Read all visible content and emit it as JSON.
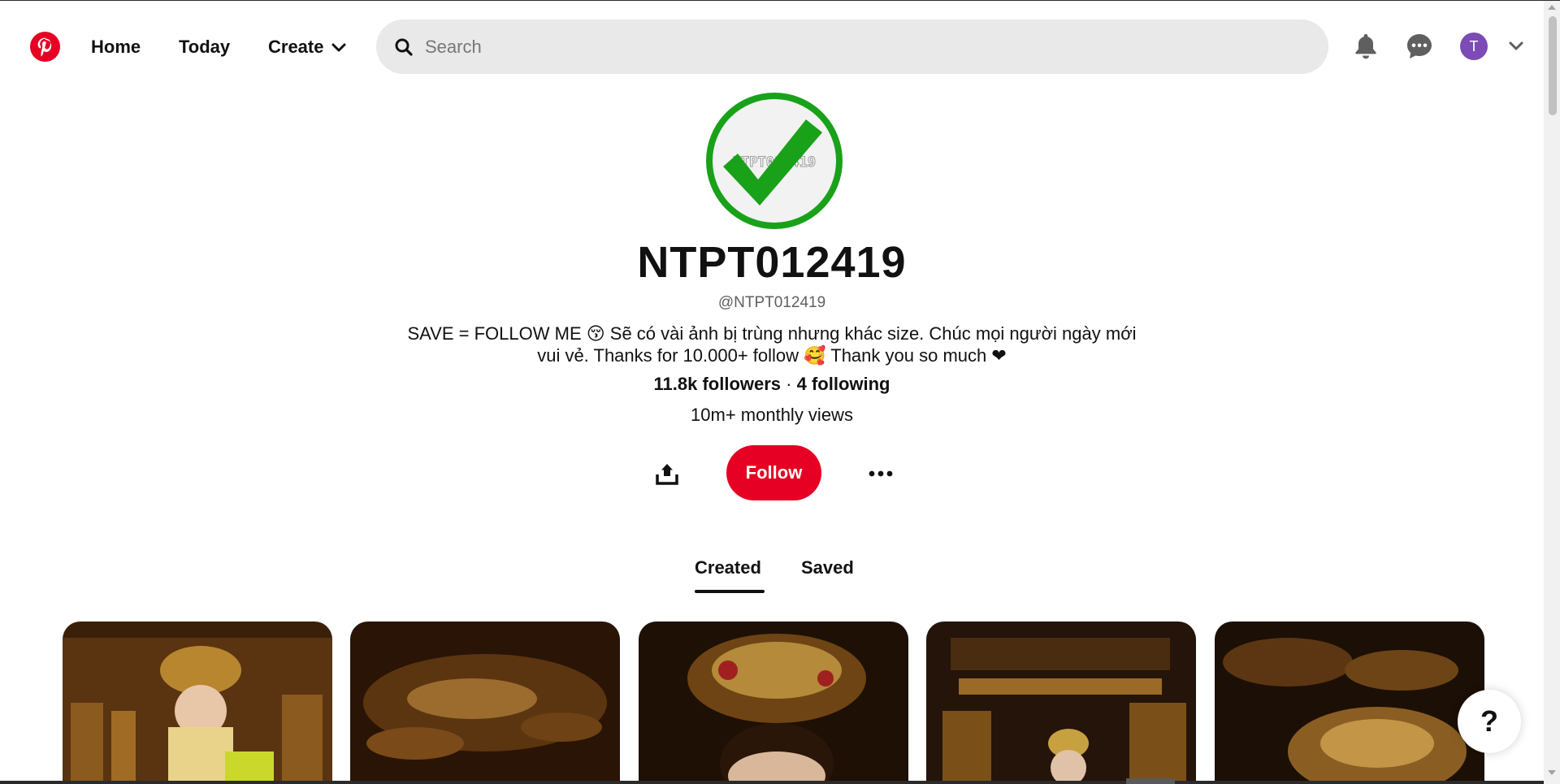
{
  "header": {
    "nav": {
      "home": "Home",
      "today": "Today",
      "create": "Create"
    },
    "search": {
      "placeholder": "Search",
      "value": ""
    },
    "account": {
      "avatar_initial": "T"
    }
  },
  "profile": {
    "name": "NTPT012419",
    "handle": "@NTPT012419",
    "bio": "SAVE = FOLLOW ME 😚 Sẽ có vài ảnh bị trùng nhưng khác size. Chúc mọi người ngày mới vui vẻ. Thanks for 10.000+ follow 🥰 Thank you so much ❤",
    "followers": "11.8k followers",
    "separator": "·",
    "following": "4 following",
    "monthly_views": "10m+ monthly views",
    "follow_label": "Follow",
    "picture_watermark": "NTPT012419"
  },
  "tabs": {
    "created": "Created",
    "saved": "Saved",
    "selected": "Created"
  },
  "help": {
    "label": "?"
  },
  "colors": {
    "brand_red": "#e60023",
    "avatar_purple": "#7c4bb5",
    "check_green": "#1aa11a",
    "search_bg": "#e9e9e9"
  },
  "icons": [
    "pinterest-logo-icon",
    "chevron-down-icon",
    "search-icon",
    "bell-icon",
    "chat-bubble-icon",
    "share-icon",
    "more-icon"
  ]
}
